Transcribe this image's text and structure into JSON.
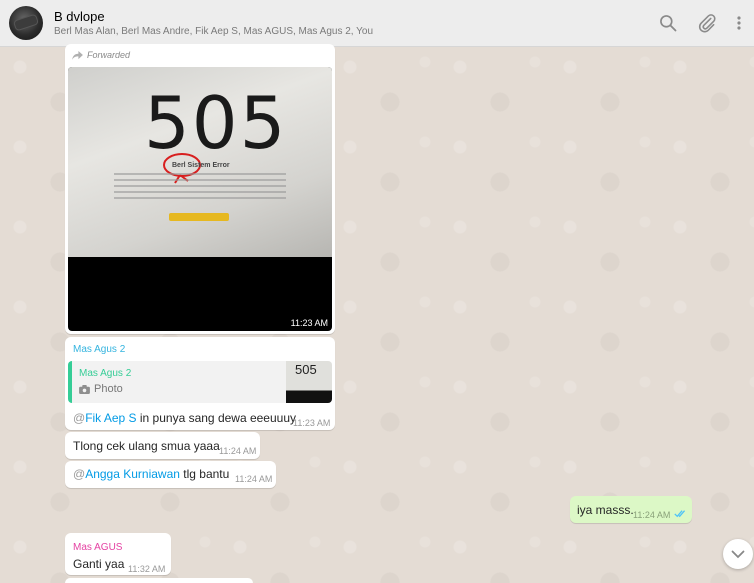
{
  "header": {
    "title": "B dvlope",
    "participants": "Berl Mas Alan, Berl Mas Andre, Fik Aep S, Mas AGUS, Mas Agus 2, You"
  },
  "messages": {
    "m1": {
      "forwarded_label": "Forwarded",
      "image_text": "505",
      "image_caption": "Berl Sistem Error",
      "time": "11:23 AM"
    },
    "m2": {
      "sender": "Mas Agus 2",
      "quote_sender": "Mas Agus 2",
      "quote_type": "Photo",
      "quote_thumb_text": "505",
      "mention_at": "@",
      "mention": "Fik Aep S",
      "text": " in punya sang dewa eeeuuuy",
      "time": "11:23 AM"
    },
    "m3": {
      "text": "Tlong cek ulang smua yaaa",
      "time": "11:24 AM"
    },
    "m4": {
      "mention_at": "@",
      "mention": "Angga Kurniawan",
      "text": " tlg bantu",
      "time": "11:24 AM"
    },
    "m5": {
      "text": "iya masss.",
      "time": "11:24 AM",
      "status": "read"
    },
    "m6": {
      "sender": "Mas AGUS",
      "text": "Ganti yaa",
      "time": "11:32 AM"
    }
  },
  "colors": {
    "header_bg": "#ededed",
    "chat_bg": "#e5ddd5",
    "incoming": "#ffffff",
    "outgoing": "#dcf8c6",
    "mention": "#039be5",
    "sender_agus2": "#35b4df",
    "sender_agus": "#e542a3",
    "read_ticks": "#4fc3f7"
  }
}
